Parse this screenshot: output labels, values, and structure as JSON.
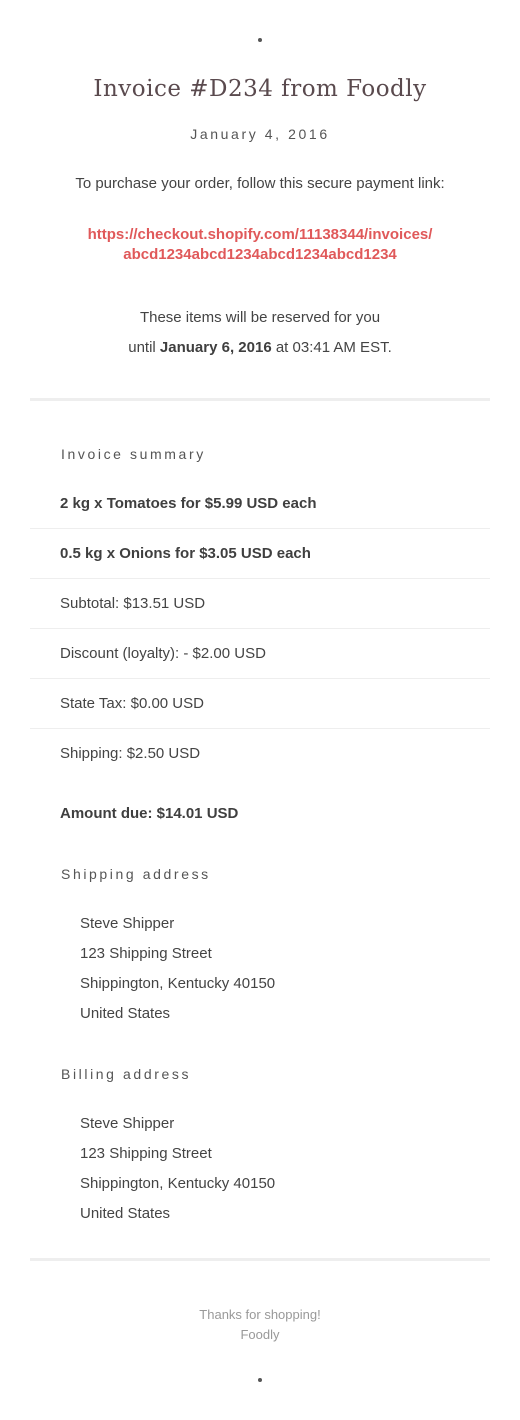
{
  "invoice": {
    "title": "Invoice #D234 from Foodly",
    "date": "January 4, 2016",
    "intro": "To purchase your order, follow this secure payment link:",
    "payment_link": "https://checkout.shopify.com/11138344/invoices/abcd1234abcd1234abcd1234abcd1234",
    "reserve_line1": "These items will be reserved for you",
    "reserve_until_prefix": "until ",
    "reserve_date": "January 6, 2016",
    "reserve_time_suffix": " at 03:41 AM EST."
  },
  "summary": {
    "heading": "Invoice summary",
    "items": [
      "2 kg x Tomatoes for $5.99 USD each",
      "0.5 kg x Onions for $3.05 USD each"
    ],
    "subtotal": "Subtotal: $13.51 USD",
    "discount": "Discount (loyalty): - $2.00 USD",
    "tax": "State Tax: $0.00 USD",
    "shipping": "Shipping: $2.50 USD",
    "amount_due": "Amount due: $14.01 USD"
  },
  "shipping_address": {
    "heading": "Shipping address",
    "name": "Steve Shipper",
    "street": "123 Shipping Street",
    "city": "Shippington, Kentucky 40150",
    "country": "United States"
  },
  "billing_address": {
    "heading": "Billing address",
    "name": "Steve Shipper",
    "street": "123 Shipping Street",
    "city": "Shippington, Kentucky 40150",
    "country": "United States"
  },
  "footer": {
    "thanks": "Thanks for shopping!",
    "shop_name": "Foodly"
  },
  "colors": {
    "link": "#e0595a",
    "title": "#5a4a4e",
    "divider": "#eeeeee"
  }
}
